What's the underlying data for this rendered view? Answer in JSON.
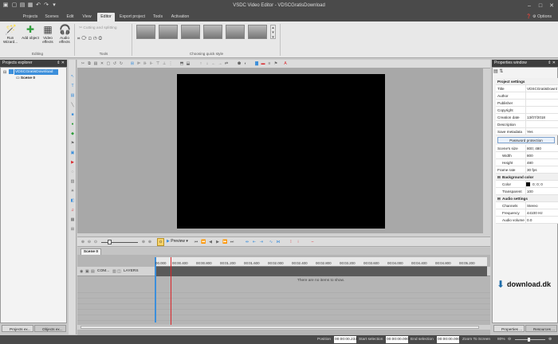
{
  "window": {
    "title": "VSDC Video Editor - VDSCGratisDownload"
  },
  "menu": {
    "tabs": [
      "Projects",
      "Scenes",
      "Edit",
      "View",
      "Editor",
      "Export project",
      "Tools",
      "Activation"
    ],
    "options": "Options"
  },
  "ribbon": {
    "run_wizard": "Run Wizard...",
    "add_object": "Add object",
    "video_effects": "Video effects",
    "audio_effects": "Audio effects",
    "editing_group": "Editing",
    "cutting": "Cutting and splitting",
    "tools_group": "Tools",
    "quick_style_group": "Choosing quick style"
  },
  "projects_explorer": {
    "title": "Projects explorer",
    "project_name": "VDSCGratisDownload",
    "scene": "Scene 0",
    "tab_projects": "Projects ex...",
    "tab_objects": "Objects ex..."
  },
  "timeline": {
    "preview": "Preview",
    "scene_tab": "Scene 0",
    "ticks": [
      "00.000",
      "00:00.400",
      "00:00.800",
      "00:01.200",
      "00:01.600",
      "00:02.000",
      "00:02.400",
      "00:02.800",
      "00:03.200",
      "00:03.600",
      "00:04.000",
      "00:04.400",
      "00:04.800",
      "00:05.200"
    ],
    "track_label": "COM...",
    "layers": "LAYERS",
    "empty": "There are no items to show."
  },
  "properties": {
    "title": "Properties window",
    "section_project": "Project settings",
    "rows": {
      "title_k": "Title",
      "title_v": "VDSCGratisDownl",
      "author_k": "Author",
      "author_v": "",
      "publisher_k": "Publisher",
      "publisher_v": "",
      "copyright_k": "Copyright",
      "copyright_v": "",
      "creation_k": "Creation date",
      "creation_v": "13/07/2018",
      "description_k": "Description",
      "description_v": "",
      "savemeta_k": "Save metadata",
      "savemeta_v": "Yes"
    },
    "password_btn": "Password protection",
    "scene_size_k": "Scene's size",
    "scene_size_v": "800; 480",
    "width_k": "Width",
    "width_v": "800",
    "height_k": "Height",
    "height_v": "480",
    "framerate_k": "Frame rate",
    "framerate_v": "30 fps",
    "section_bg": "Background color",
    "color_k": "Color",
    "color_v": "0; 0; 0",
    "transp_k": "Transparent",
    "transp_v": "100",
    "section_audio": "Audio settings",
    "channels_k": "Channels",
    "channels_v": "Stereo",
    "freq_k": "Frequency",
    "freq_v": "44100 Hz",
    "vol_k": "Audio volume",
    "vol_v": "0.0",
    "tab_properties": "Properties ...",
    "tab_resources": "Resources ..."
  },
  "watermark": {
    "text": "download.dk"
  },
  "status": {
    "position_k": "Position",
    "position_v": "00:00:00.233",
    "start_k": "Start selection",
    "start_v": "00:00:00.000",
    "end_k": "End selection",
    "end_v": "00:00:00.000",
    "zoom_label": "Zoom To Screen",
    "zoom_value": "80%"
  },
  "colors": {
    "dark": "#4a4a4a",
    "accent": "#3c8fdb",
    "playhead": "#d9262a"
  }
}
